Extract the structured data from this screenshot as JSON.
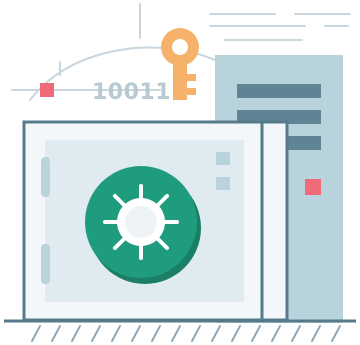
{
  "illustration": {
    "binary_code": "10011",
    "icons": [
      "key-icon",
      "safe-icon",
      "server-icon",
      "vault-dial-icon"
    ],
    "colors": {
      "outline": "#567b8a",
      "safe_body": "#f3f7f9",
      "safe_inner": "#dfeaf1",
      "server_body": "#b9d3dd",
      "server_dark": "#5f8594",
      "key": "#f6b26b",
      "dial": "#1f9c7d",
      "dial_shadow": "#1a7f66",
      "accent": "#f06b7a",
      "sketch_lines": "#b9c9d3"
    }
  }
}
